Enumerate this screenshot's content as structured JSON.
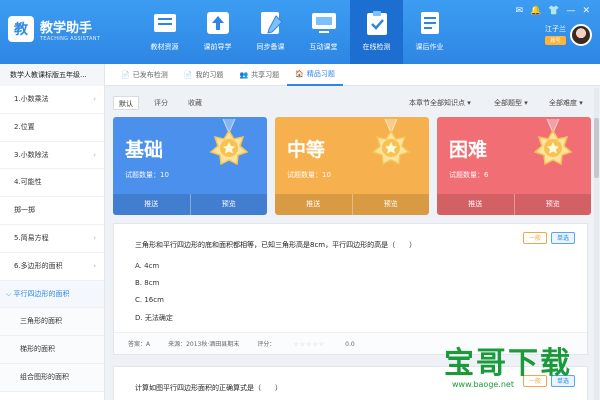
{
  "app": {
    "logo_char": "教",
    "title": "教学助手",
    "subtitle": "TEACHING ASSISTANT"
  },
  "nav": [
    {
      "label": "教材资源",
      "icon": "textbook-icon"
    },
    {
      "label": "课前导学",
      "icon": "upload-guide-icon"
    },
    {
      "label": "同步备课",
      "icon": "pen-paper-icon"
    },
    {
      "label": "互动课堂",
      "icon": "classroom-screen-icon"
    },
    {
      "label": "在线检测",
      "icon": "clipboard-check-icon"
    },
    {
      "label": "课后作业",
      "icon": "homework-icon"
    }
  ],
  "nav_active": 4,
  "user": {
    "name": "江子兰",
    "badge": "账号"
  },
  "book": "数学人教课标版五年级...",
  "tabs": [
    {
      "label": "已发布检测",
      "icon": "📄"
    },
    {
      "label": "我的习题",
      "icon": "📄"
    },
    {
      "label": "共享习题",
      "icon": "👥"
    },
    {
      "label": "精品习题",
      "icon": "🏠"
    }
  ],
  "sidebar": [
    {
      "label": "1.小数乘法",
      "chev": "›",
      "type": "top"
    },
    {
      "label": "2.位置",
      "chev": "",
      "type": "top"
    },
    {
      "label": "3.小数除法",
      "chev": "›",
      "type": "top"
    },
    {
      "label": "4.可能性",
      "chev": "",
      "type": "top"
    },
    {
      "label": "掷一掷",
      "chev": "",
      "type": "top"
    },
    {
      "label": "5.简易方程",
      "chev": "›",
      "type": "top"
    },
    {
      "label": "6.多边形的面积",
      "chev": "›",
      "type": "top"
    },
    {
      "label": "平行四边形的面积",
      "chev": "",
      "type": "active"
    },
    {
      "label": "三角形的面积",
      "chev": "",
      "type": "sub"
    },
    {
      "label": "梯形的面积",
      "chev": "",
      "type": "sub"
    },
    {
      "label": "组合图形的面积",
      "chev": "",
      "type": "sub"
    }
  ],
  "filters": {
    "sort": [
      "默认",
      "评分",
      "收藏"
    ],
    "chapter": "本章节全部知识点 ▾",
    "qtype": "全部题型 ▾",
    "difficulty": "全部难度 ▾"
  },
  "cards": [
    {
      "title": "基础",
      "count_label": "试题数量：10",
      "preview": "推送",
      "view": "预览",
      "color": "#4a90ec"
    },
    {
      "title": "中等",
      "count_label": "试题数量：10",
      "preview": "推送",
      "view": "预览",
      "color": "#f6b04d"
    },
    {
      "title": "困难",
      "count_label": "试题数量：6",
      "preview": "推送",
      "view": "预览",
      "color": "#f06e74"
    }
  ],
  "question1": {
    "text": "三角形和平行四边形的底和面积都相等，已知三角形高是8cm，平行四边形的高是（　　）",
    "options": [
      "A. 4cm",
      "B. 8cm",
      "C. 16cm",
      "D. 无法确定"
    ],
    "level": "一般",
    "type": "单选",
    "answer": "答案：A",
    "source": "来源：2013秋·酒田县期末",
    "rating_label": "评分：",
    "stars": "☆☆☆☆☆",
    "score": "0.0"
  },
  "question2": {
    "text": "计算如图平行四边形面积的正确算式是（　　）",
    "level": "一般",
    "type": "单选"
  },
  "topbar_icons": {
    "mail": "✉",
    "bell": "🔔",
    "shirt": "👕",
    "min": "—",
    "close": "✕"
  },
  "watermark": {
    "text": "宝哥下载",
    "url": "www.baoge.net"
  },
  "colors": {
    "primary": "#2d86e3",
    "basic": "#4a90ec",
    "medium": "#f6b04d",
    "hard": "#f06e74"
  }
}
